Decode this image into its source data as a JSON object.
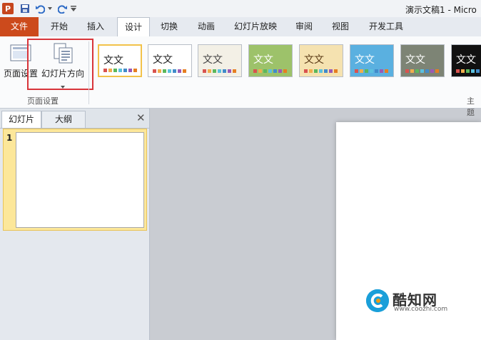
{
  "app": {
    "logo_letter": "P",
    "doc_title": "演示文稿1 - Micro"
  },
  "quick_access": {
    "save_icon": "save-icon",
    "undo_icon": "undo-icon",
    "redo_icon": "redo-icon",
    "customize_icon": "customize-icon"
  },
  "tabs": {
    "file": "文件",
    "home": "开始",
    "insert": "插入",
    "design": "设计",
    "transitions": "切换",
    "animations": "动画",
    "slideshow": "幻灯片放映",
    "review": "审阅",
    "view": "视图",
    "developer": "开发工具"
  },
  "ribbon": {
    "page_setup_label": "页面设置",
    "slide_orientation_label": "幻灯片方向",
    "group_page_setup": "页面设置",
    "group_themes": "主题"
  },
  "themes": [
    {
      "text": "文文",
      "bg": "#ffffff",
      "fg": "#222222"
    },
    {
      "text": "文文",
      "bg": "#ffffff",
      "fg": "#222222"
    },
    {
      "text": "文文",
      "bg": "#f3f0e6",
      "fg": "#444444"
    },
    {
      "text": "文文",
      "bg": "#9dc26a",
      "fg": "#ffffff"
    },
    {
      "text": "文文",
      "bg": "#f5e2b0",
      "fg": "#5b3b16"
    },
    {
      "text": "文文",
      "bg": "#5ab0e0",
      "fg": "#ffffff"
    },
    {
      "text": "文文",
      "bg": "#7d8475",
      "fg": "#ffffff"
    },
    {
      "text": "文文",
      "bg": "#111111",
      "fg": "#ffffff"
    }
  ],
  "panel": {
    "tab_slides": "幻灯片",
    "tab_outline": "大纲",
    "close": "✕",
    "slide_number": "1"
  },
  "watermark": {
    "name": "酷知网",
    "url": "www.coozhi.com"
  },
  "colors": {
    "file_tab": "#cc4a1c",
    "highlight_box": "#d8343a",
    "selected_thumb": "#fce79a"
  }
}
